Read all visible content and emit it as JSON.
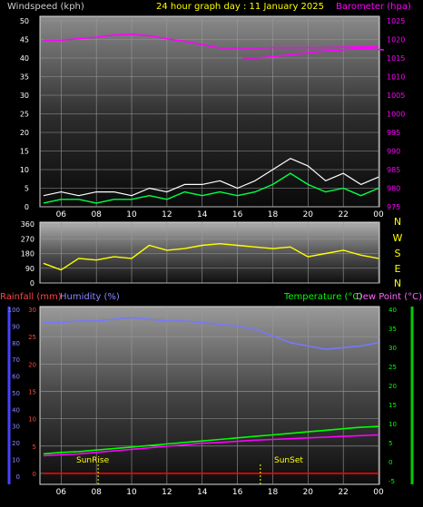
{
  "header": {
    "wind_label": "Windspeed (kph)",
    "title": "24 hour graph day : 11 January 2025",
    "baro_label": "Barometer (hpa)"
  },
  "colors": {
    "wind_avg": "#ffffff",
    "wind_gust": "#00ff44",
    "barometer": "#ff00ff",
    "direction": "#ffff00",
    "rainfall": "#ff0000",
    "humidity": "#7777ff",
    "temperature": "#00ff00",
    "dewpoint": "#ff00ff",
    "sun_markers": "#ffff00",
    "grid": "#9a9a9a"
  },
  "x_ticks": [
    "06",
    "08",
    "10",
    "12",
    "14",
    "16",
    "18",
    "20",
    "22",
    "00"
  ],
  "bottom_labels": {
    "sunrise_time": "SunRise",
    "sunset_time": "SunSet"
  },
  "chart_data": [
    {
      "type": "line",
      "name": "windspeed_barometer",
      "y_left_label": "Windspeed (kph)",
      "y_left_ticks": [
        0,
        5,
        10,
        15,
        20,
        25,
        30,
        35,
        40,
        45,
        50
      ],
      "ylim_left": [
        0,
        50
      ],
      "y_right_label": "Barometer (hpa)",
      "y_right_ticks": [
        975,
        980,
        985,
        990,
        995,
        1000,
        1005,
        1010,
        1015,
        1020,
        1025
      ],
      "ylim_right": [
        975,
        1025
      ],
      "series": [
        {
          "name": "Barometer (hpa)",
          "x": [
            5,
            6,
            7,
            8,
            9,
            10,
            11,
            11.5,
            12,
            12.5,
            13,
            14,
            15,
            16,
            17,
            18,
            19,
            20,
            21,
            22,
            23,
            24
          ],
          "values": [
            1019.8,
            1019.8,
            1020.2,
            1020.6,
            1021.2,
            1021.4,
            1021.0,
            1020.6,
            1020.2,
            1019.8,
            1019.5,
            1018.6,
            1017.7,
            1017.7,
            1017.7,
            1017.8,
            1017.8,
            1017.8,
            1017.8,
            1017.9,
            1018.0,
            1018.0
          ]
        },
        {
          "name": "Barometer (hpa)",
          "x": [
            16.3,
            17,
            18,
            19,
            20,
            21,
            22,
            23,
            24.3
          ],
          "values": [
            1015.0,
            1015.0,
            1015.4,
            1015.9,
            1016.4,
            1016.9,
            1017.2,
            1017.7,
            1017.2
          ]
        },
        {
          "name": "Windspeed (kph)",
          "x": [
            5,
            6,
            7,
            8,
            9,
            10,
            11,
            12,
            13,
            14,
            15,
            16,
            17,
            18,
            19,
            20,
            21,
            22,
            23,
            24
          ],
          "values": [
            3,
            4,
            3,
            4,
            4,
            3,
            5,
            4,
            6,
            6,
            7,
            5,
            7,
            10,
            13,
            11,
            7,
            9,
            6,
            8
          ]
        },
        {
          "name": "Windspeed (kph)",
          "x": [
            5,
            6,
            7,
            8,
            9,
            10,
            11,
            12,
            13,
            14,
            15,
            16,
            17,
            18,
            19,
            20,
            21,
            22,
            23,
            24
          ],
          "values": [
            1,
            2,
            2,
            1,
            2,
            2,
            3,
            2,
            4,
            3,
            4,
            3,
            4,
            6,
            9,
            6,
            4,
            5,
            3,
            5
          ]
        }
      ]
    },
    {
      "type": "line",
      "name": "wind_direction",
      "y_left_ticks": [
        0,
        90,
        180,
        270,
        360
      ],
      "ylim_left": [
        0,
        360
      ],
      "y_right_ticks": [
        "N",
        "W",
        "S",
        "E",
        "N"
      ],
      "series": [
        {
          "name": "Wind Direction",
          "x": [
            5,
            6,
            7,
            8,
            9,
            10,
            11,
            12,
            13,
            14,
            15,
            16,
            17,
            18,
            19,
            20,
            21,
            22,
            23,
            24
          ],
          "values": [
            120,
            80,
            150,
            140,
            160,
            150,
            230,
            200,
            210,
            230,
            240,
            230,
            220,
            210,
            220,
            160,
            180,
            200,
            170,
            150
          ]
        }
      ]
    },
    {
      "type": "line",
      "name": "rain_humidity_temperature",
      "y_left_label": "Rainfall (mm)",
      "y_left_ticks": [
        0,
        5,
        10,
        15,
        20,
        25,
        30
      ],
      "ylim_left": [
        -2,
        30
      ],
      "y_humidity_label": "Humidity (%)",
      "y_humidity_ticks": [
        0,
        10,
        20,
        30,
        40,
        50,
        60,
        70,
        80,
        90,
        100
      ],
      "ylim_humidity": [
        -5,
        100
      ],
      "y_right_label": "Temperature (°C)",
      "y_right2_label": "Dew Point (°C)",
      "y_right_ticks": [
        -5,
        0,
        5,
        10,
        15,
        20,
        25,
        30,
        35,
        40
      ],
      "ylim_right": [
        -6,
        40
      ],
      "series": [
        {
          "name": "Humidity (%)",
          "x": [
            5,
            6,
            7,
            8,
            9,
            10,
            11,
            12,
            13,
            14,
            15,
            16,
            17,
            18,
            19,
            20,
            21,
            22,
            23,
            24
          ],
          "values": [
            92,
            92,
            93,
            93,
            94,
            95,
            94,
            93,
            93,
            92,
            91,
            90,
            88,
            84,
            80,
            78,
            76,
            77,
            78,
            80
          ]
        },
        {
          "name": "Temperature (°C)",
          "x": [
            5,
            6,
            7,
            8,
            9,
            10,
            11,
            12,
            13,
            14,
            15,
            16,
            17,
            18,
            19,
            20,
            21,
            22,
            23,
            24
          ],
          "values": [
            2,
            2.4,
            2.6,
            3,
            3.4,
            3.8,
            4.2,
            4.6,
            5,
            5.4,
            5.8,
            6.2,
            6.6,
            7,
            7.4,
            7.8,
            8.2,
            8.6,
            9,
            9.2
          ]
        },
        {
          "name": "Dew Point (°C)",
          "x": [
            5,
            6,
            7,
            8,
            9,
            10,
            11,
            12,
            13,
            14,
            15,
            16,
            17,
            18,
            19,
            20,
            21,
            22,
            23,
            24
          ],
          "values": [
            1.5,
            1.8,
            2,
            2.4,
            2.8,
            3.2,
            3.6,
            4,
            4.4,
            4.8,
            5,
            5.3,
            5.6,
            5.8,
            6,
            6.2,
            6.4,
            6.6,
            6.8,
            7
          ]
        },
        {
          "name": "Rainfall (mm)",
          "x": [
            5,
            6,
            7,
            8,
            9,
            10,
            11,
            12,
            13,
            14,
            15,
            16,
            17,
            18,
            19,
            20,
            21,
            22,
            23,
            24
          ],
          "values": [
            0,
            0,
            0,
            0,
            0,
            0,
            0,
            0,
            0,
            0,
            0,
            0,
            0,
            0,
            0,
            0,
            0,
            0,
            0,
            0
          ]
        }
      ]
    }
  ]
}
